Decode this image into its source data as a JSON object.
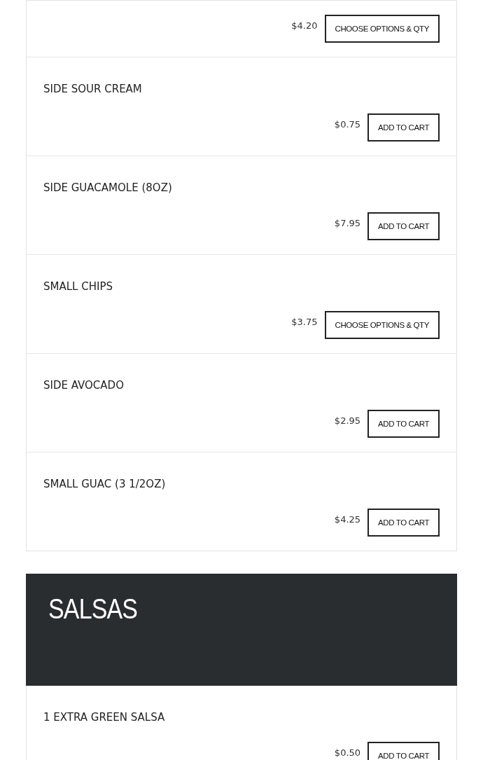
{
  "sections": [
    {
      "items": [
        {
          "price": "$4.20",
          "button": "CHOOSE OPTIONS & QTY"
        },
        {
          "name": "SIDE SOUR CREAM",
          "price": "$0.75",
          "button": "ADD TO CART"
        },
        {
          "name": "SIDE GUACAMOLE (8OZ)",
          "price": "$7.95",
          "button": "ADD TO CART"
        },
        {
          "name": "SMALL CHIPS",
          "price": "$3.75",
          "button": "CHOOSE OPTIONS & QTY"
        },
        {
          "name": "SIDE AVOCADO",
          "price": "$2.95",
          "button": "ADD TO CART"
        },
        {
          "name": "SMALL GUAC (3 1/2OZ)",
          "price": "$4.25",
          "button": "ADD TO CART"
        }
      ]
    },
    {
      "title": "SALSAS",
      "items": [
        {
          "name": "1 EXTRA GREEN SALSA",
          "price": "$0.50",
          "button": "ADD TO CART"
        }
      ]
    }
  ]
}
